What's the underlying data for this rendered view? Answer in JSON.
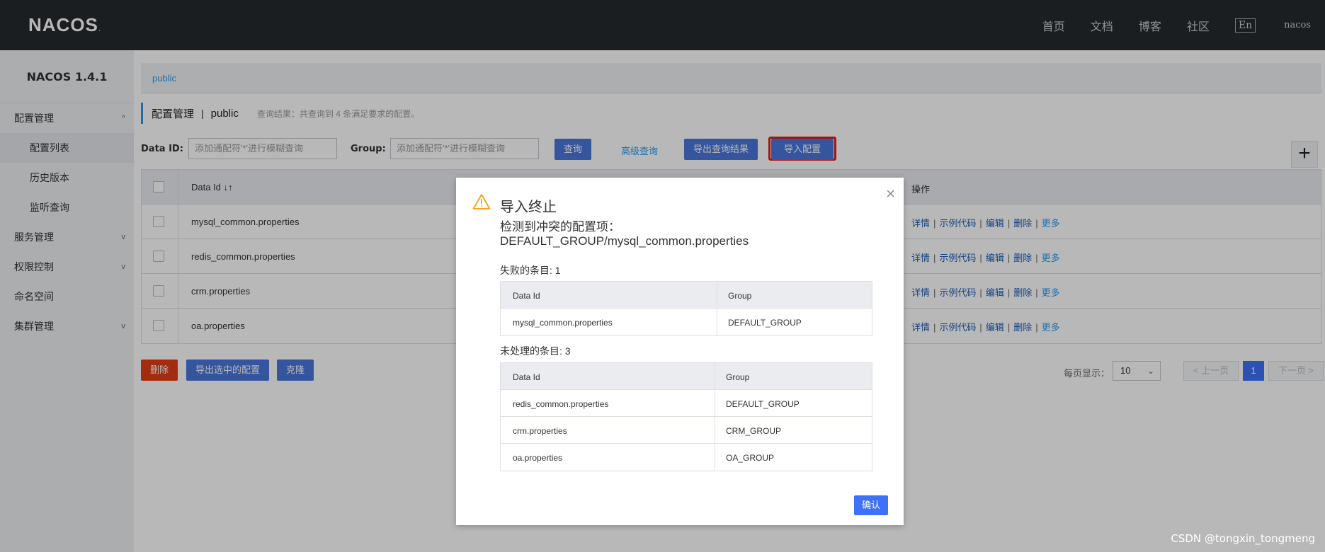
{
  "topbar": {
    "logo": "NACOS",
    "logo_dot": ".",
    "nav": [
      "首页",
      "文档",
      "博客",
      "社区"
    ],
    "lang": "En",
    "user": "nacos"
  },
  "sidebar": {
    "version": "NACOS 1.4.1",
    "items": [
      {
        "label": "配置管理",
        "chevron": "^"
      },
      {
        "label": "配置列表"
      },
      {
        "label": "历史版本"
      },
      {
        "label": "监听查询"
      },
      {
        "label": "服务管理",
        "chevron": "v"
      },
      {
        "label": "权限控制",
        "chevron": "v"
      },
      {
        "label": "命名空间"
      },
      {
        "label": "集群管理",
        "chevron": "v"
      }
    ]
  },
  "main": {
    "namespace": "public",
    "title": "配置管理",
    "title_sep": "|",
    "title_ns": "public",
    "result_text": "查询结果：共查询到 4 条满足要求的配置。",
    "dataid_label": "Data ID:",
    "dataid_placeholder": "添加通配符'*'进行模糊查询",
    "group_label": "Group:",
    "group_placeholder": "添加通配符'*'进行模糊查询",
    "query_btn": "查询",
    "advanced_link": "高级查询",
    "export_btn": "导出查询结果",
    "import_btn": "导入配置",
    "plus": "+"
  },
  "table": {
    "header_dataid": "Data Id",
    "header_sort": "↓↑",
    "header_ops": "操作",
    "rows": [
      {
        "data_id": "mysql_common.properties"
      },
      {
        "data_id": "redis_common.properties"
      },
      {
        "data_id": "crm.properties"
      },
      {
        "data_id": "oa.properties"
      }
    ],
    "ops": {
      "detail": "详情",
      "sample": "示例代码",
      "edit": "编辑",
      "delete": "删除",
      "more": "更多",
      "sep": "|"
    }
  },
  "bottom": {
    "delete_btn": "删除",
    "export_selected_btn": "导出选中的配置",
    "clone_btn": "克隆",
    "page_size_label": "每页显示：",
    "page_size": "10",
    "prev": "< 上一页",
    "current_page": "1",
    "next": "下一页 >"
  },
  "dialog": {
    "title": "导入终止",
    "message": "检测到冲突的配置项：DEFAULT_GROUP/mysql_common.properties",
    "failed_label": "失败的条目: 1",
    "unhandled_label": "未处理的条目: 3",
    "col_dataid": "Data Id",
    "col_group": "Group",
    "failed_rows": [
      {
        "data_id": "mysql_common.properties",
        "group": "DEFAULT_GROUP"
      }
    ],
    "unhandled_rows": [
      {
        "data_id": "redis_common.properties",
        "group": "DEFAULT_GROUP"
      },
      {
        "data_id": "crm.properties",
        "group": "CRM_GROUP"
      },
      {
        "data_id": "oa.properties",
        "group": "OA_GROUP"
      }
    ],
    "confirm_btn": "确认",
    "close": "×"
  },
  "watermark": "CSDN @tongxin_tongmeng",
  "colors": {
    "accent": "#3e71f7",
    "danger": "#e23d16",
    "warning": "#f5a623",
    "topbar": "#252a2f"
  }
}
